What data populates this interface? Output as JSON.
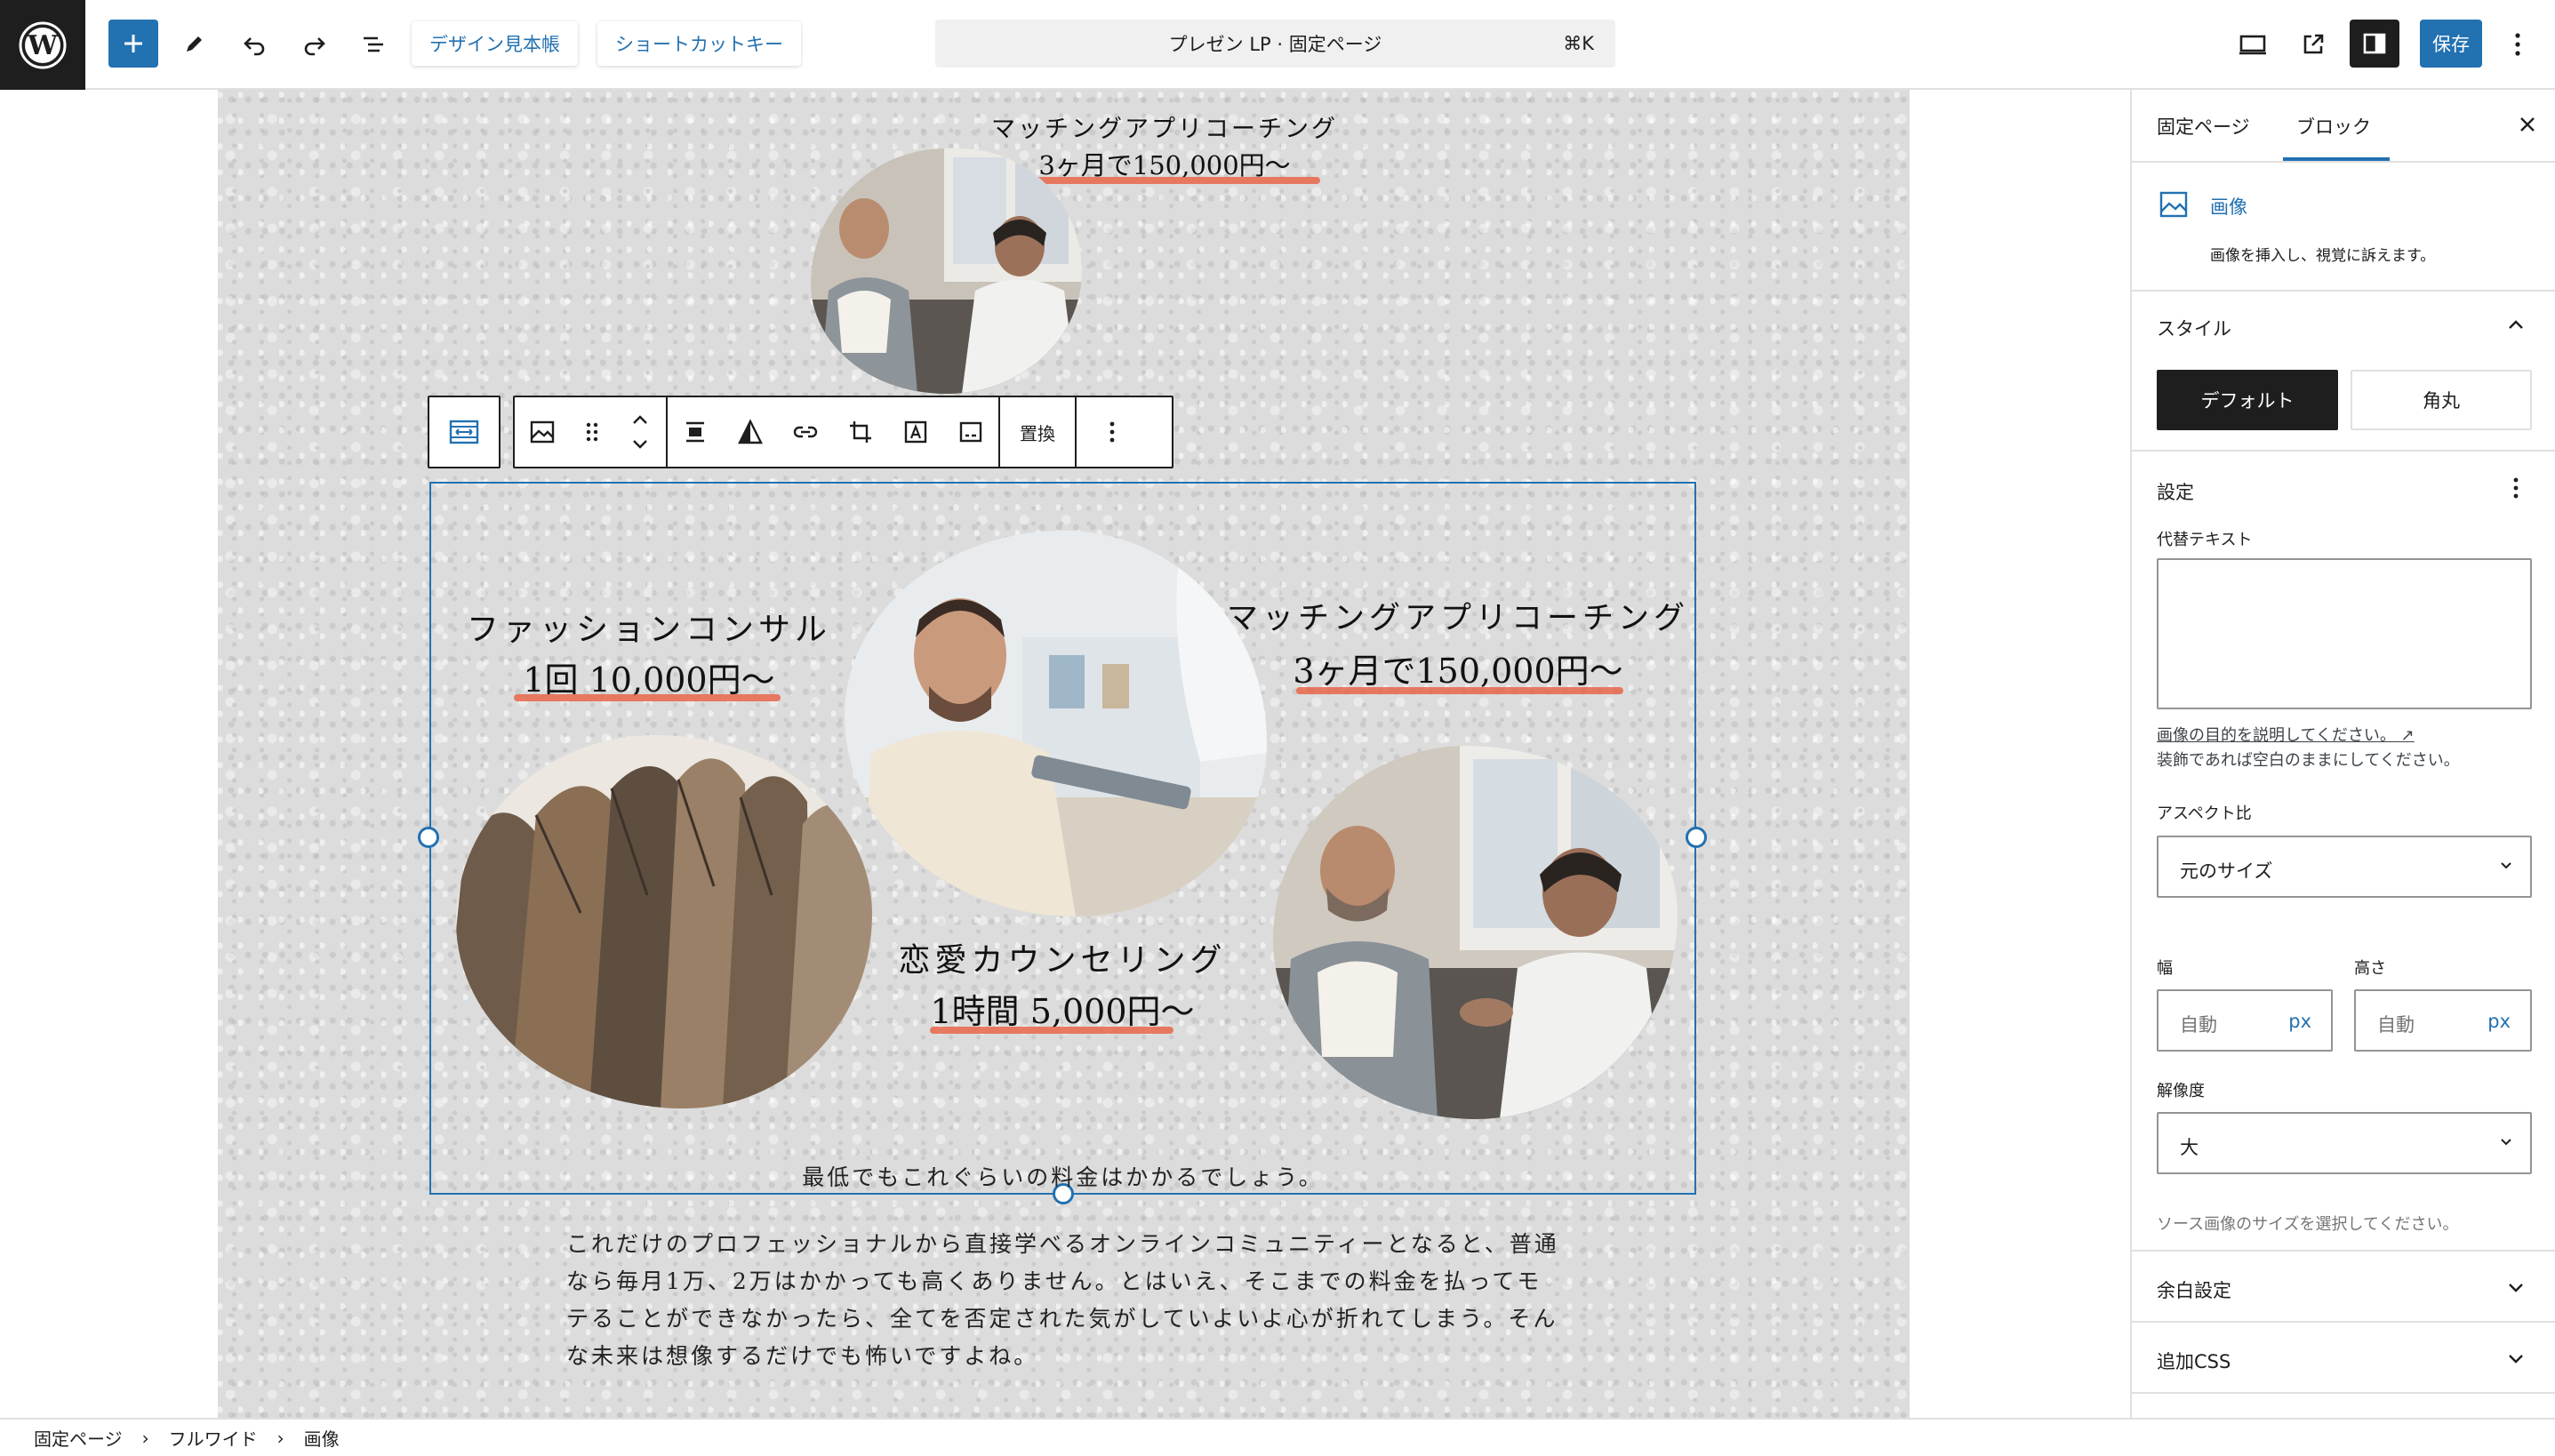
{
  "topbar": {
    "design_book_label": "デザイン見本帳",
    "shortcut_label": "ショートカットキー",
    "document_title": "プレゼン LP · 固定ページ",
    "command_shortcut": "⌘K",
    "save_label": "保存"
  },
  "canvas": {
    "top_card": {
      "title": "マッチングアプリコーチング",
      "price": "3ヶ月で150,000円～"
    },
    "image_block": {
      "fashion_title": "ファッションコンサル",
      "fashion_price": "1回 10,000円～",
      "matching_title": "マッチングアプリコーチング",
      "matching_price": "3ヶ月で150,000円～",
      "love_title": "恋愛カウンセリング",
      "love_price": "1時間 5,000円～"
    },
    "toolbar": {
      "replace_label": "置換"
    },
    "caption": "最低でもこれぐらいの料金はかかるでしょう。",
    "paragraph_lines": [
      "これだけのプロフェッショナルから直接学べるオンラインコミュニティーとなると、普通",
      "なら毎月1万、2万はかかっても高くありません。とはいえ、そこまでの料金を払ってモ",
      "テることができなかったら、全てを否定された気がしていよいよ心が折れてしまう。そん",
      "な未来は想像するだけでも怖いですよね。"
    ]
  },
  "sidebar": {
    "tab_page": "固定ページ",
    "tab_block": "ブロック",
    "block_name": "画像",
    "block_description": "画像を挿入し、視覚に訴えます。",
    "styles_heading": "スタイル",
    "style_default": "デフォルト",
    "style_rounded": "角丸",
    "settings_heading": "設定",
    "alt_label": "代替テキスト",
    "alt_value": "",
    "alt_help_link": "画像の目的を説明してください。",
    "alt_help_text": "装飾であれば空白のままにしてください。",
    "aspect_label": "アスペクト比",
    "aspect_value": "元のサイズ",
    "width_label": "幅",
    "height_label": "高さ",
    "width_placeholder": "自動",
    "height_placeholder": "自動",
    "unit": "px",
    "resolution_label": "解像度",
    "resolution_value": "大",
    "resolution_help": "ソース画像のサイズを選択してください。",
    "spacing_heading": "余白設定",
    "css_heading": "追加CSS"
  },
  "breadcrumb": [
    "固定ページ",
    "フルワイド",
    "画像"
  ],
  "colors": {
    "accent": "#2271b1",
    "dark": "#1e1e1e",
    "underline": "#e8664a"
  }
}
